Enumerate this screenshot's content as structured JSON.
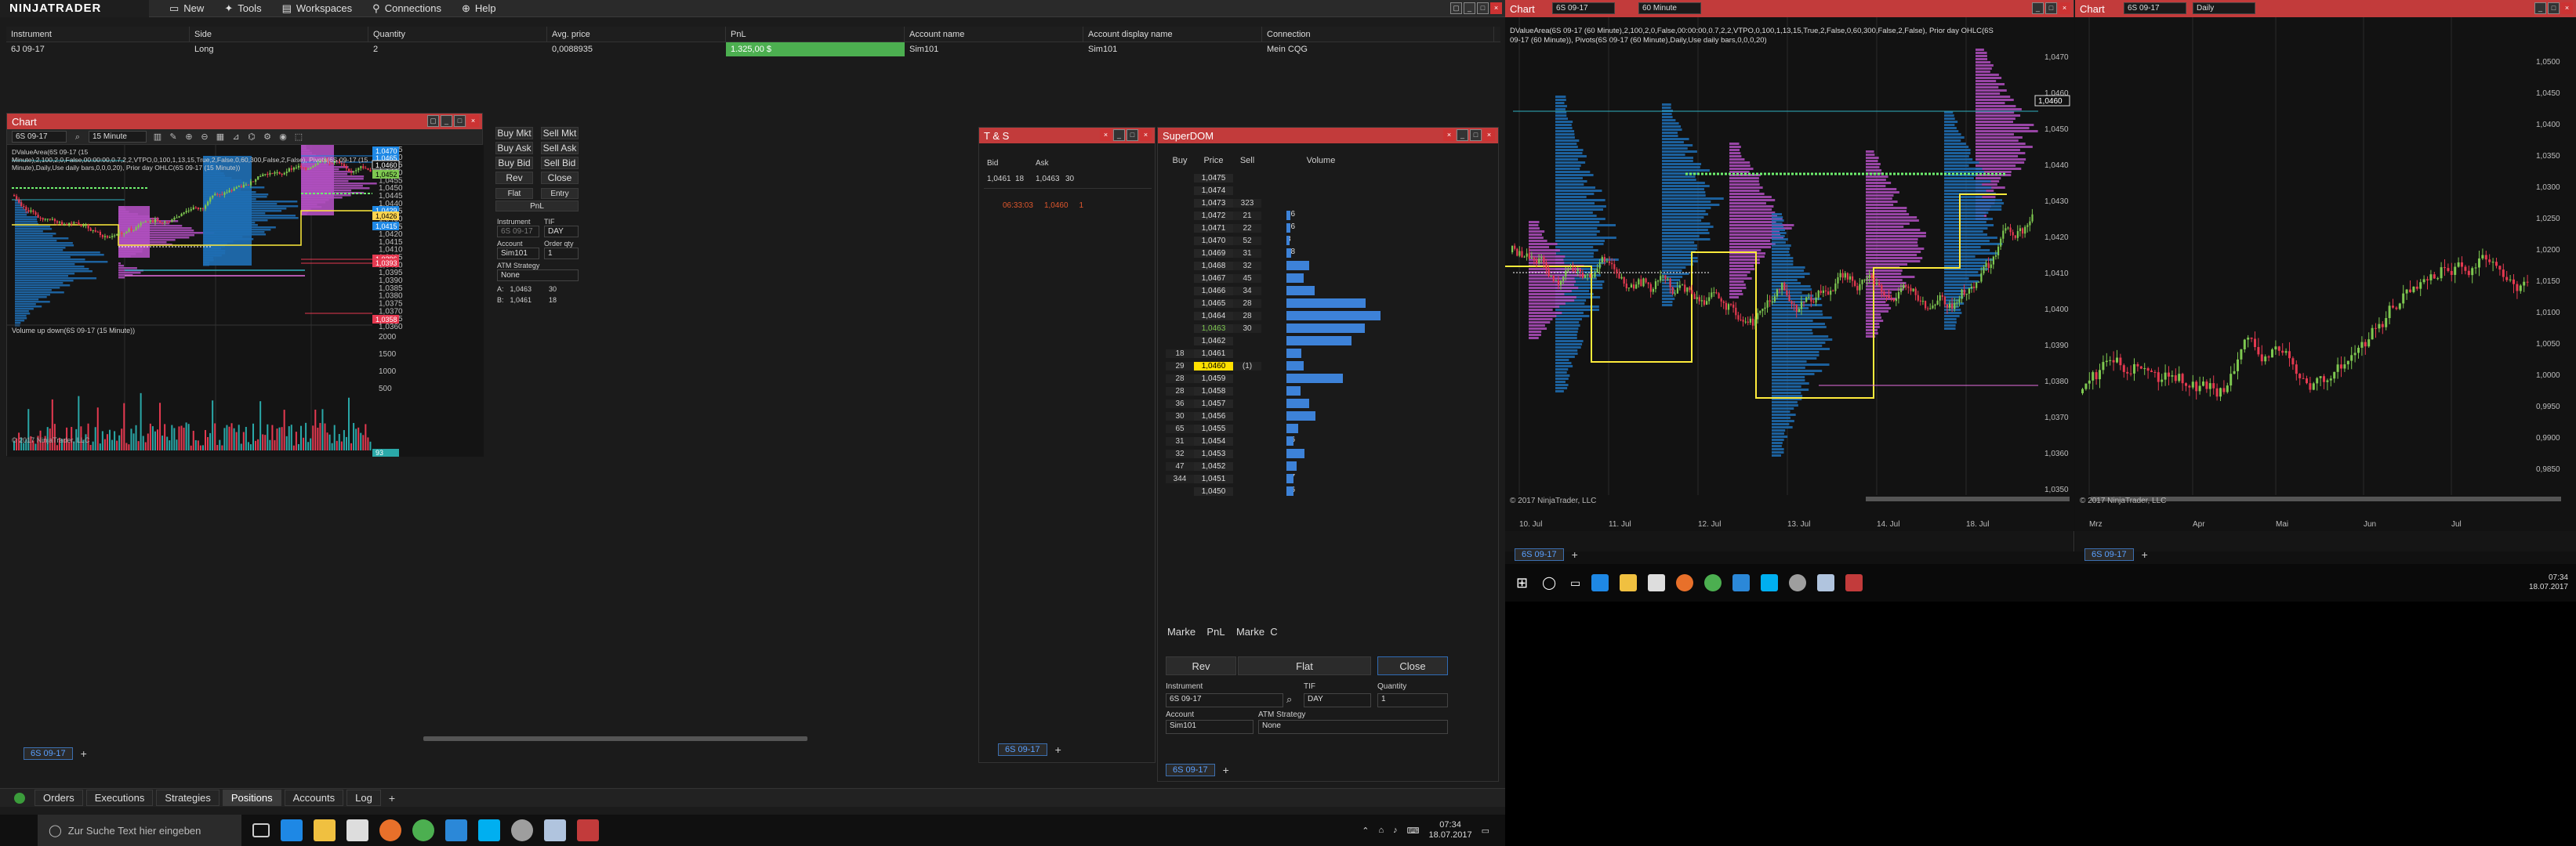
{
  "app": {
    "logo": "NINJATRADER",
    "menu": [
      {
        "label": "New",
        "icon": "new-icon"
      },
      {
        "label": "Tools",
        "icon": "tools-icon"
      },
      {
        "label": "Workspaces",
        "icon": "workspaces-icon"
      },
      {
        "label": "Connections",
        "icon": "connections-icon"
      },
      {
        "label": "Help",
        "icon": "help-icon"
      }
    ]
  },
  "positions": {
    "headers": [
      "Instrument",
      "Side",
      "Quantity",
      "Avg. price",
      "PnL",
      "Account name",
      "Account display name",
      "Connection"
    ],
    "rows": [
      [
        "6J 09-17",
        "Long",
        "2",
        "0,0088935",
        "1.325,00 $",
        "Sim101",
        "Sim101",
        "Mein CQG"
      ]
    ],
    "pnl_color": "#4caf50"
  },
  "main_chart": {
    "title": "Chart",
    "instrument": "6S 09-17",
    "interval": "15 Minute",
    "indicator_text": "DValueArea(6S 09-17 (15 Minute),2,100,2,0,False,00:00:00,0.7,2,2,VTPO,0,100,1,13,15,True,2,False,0,60,300,False,2,False), Pivots(6S 09-17 (15 Minute),Daily,Use daily bars,0,0,0,20), Prior day OHLC(6S 09-17 (15 Minute))",
    "copyright": "© 2017 NinjaTrader, LLC",
    "volume_label": "Volume up down(6S 09-17 (15 Minute))",
    "x_labels": [
      "14. Jul",
      "18. Jul"
    ],
    "y_labels": [
      "1,0475",
      "1,0470",
      "1,0465",
      "1,0460",
      "1,0455",
      "1,0450",
      "1,0445",
      "1,0440",
      "1,0435",
      "1,0430",
      "1,0425",
      "1,0420",
      "1,0415",
      "1,0410",
      "1,0405",
      "1,0400",
      "1,0395",
      "1,0390",
      "1,0385",
      "1,0380",
      "1,0375",
      "1,0370",
      "1,0365",
      "1,0360"
    ],
    "vol_labels": [
      "2000",
      "1500",
      "1000",
      "500",
      "93"
    ],
    "price_tags": [
      {
        "label": "1,0470",
        "color": "#1e88e5"
      },
      {
        "label": "1,0465",
        "color": "#1e88e5"
      },
      {
        "label": "1,0460",
        "color": "#111111"
      },
      {
        "label": "1,0452",
        "color": "#7ec850"
      },
      {
        "label": "1,0429",
        "color": "#1e88e5"
      },
      {
        "label": "1,0426",
        "color": "#ffd54f"
      },
      {
        "label": "1,0415",
        "color": "#1e88e5"
      },
      {
        "label": "1,0396",
        "color": "#e53950"
      },
      {
        "label": "1,0393",
        "color": "#e53950"
      },
      {
        "label": "1,0358",
        "color": "#e53950"
      }
    ],
    "tab": "6S 09-17",
    "vol_tag": "93"
  },
  "chart_trader": {
    "buttons": [
      "Buy Mkt",
      "Sell Mkt",
      "Buy Ask",
      "Sell Ask",
      "Buy Bid",
      "Sell Bid",
      "Rev",
      "Close"
    ],
    "flat": "Flat",
    "entry": "Entry",
    "pnl": "PnL",
    "instrument_label": "Instrument",
    "instrument_value": "6S 09-17",
    "tif_label": "TIF",
    "tif_value": "DAY",
    "account_label": "Account",
    "account_value": "Sim101",
    "qty_label": "Order qty",
    "qty_value": "1",
    "atm_label": "ATM Strategy",
    "atm_value": "None",
    "ask_label": "A:",
    "ask_price": "1,0463",
    "ask_size": "30",
    "bid_label": "B:",
    "bid_price": "1,0461",
    "bid_size": "18"
  },
  "ts": {
    "title": "T & S",
    "bid_label": "Bid",
    "ask_label": "Ask",
    "bid_price": "1,0461",
    "bid_size": "18",
    "ask_price": "1,0463",
    "ask_size": "30",
    "time": "06:33:03",
    "last_price": "1,0460",
    "last_size": "1",
    "tab": "6S 09-17"
  },
  "superdom": {
    "title": "SuperDOM",
    "headers": [
      "Buy",
      "Price",
      "Sell",
      "Volume"
    ],
    "rows": [
      {
        "buy": "",
        "price": "1,0475",
        "sell": "",
        "vol": ""
      },
      {
        "buy": "",
        "price": "1,0474",
        "sell": "",
        "vol": ""
      },
      {
        "buy": "",
        "price": "1,0473",
        "sell": "323",
        "vol": ""
      },
      {
        "buy": "",
        "price": "1,0472",
        "sell": "21",
        "vol": "16"
      },
      {
        "buy": "",
        "price": "1,0471",
        "sell": "22",
        "vol": "16"
      },
      {
        "buy": "",
        "price": "1,0470",
        "sell": "52",
        "vol": "8"
      },
      {
        "buy": "",
        "price": "1,0469",
        "sell": "31",
        "vol": "18"
      },
      {
        "buy": "",
        "price": "1,0468",
        "sell": "32",
        "vol": "87"
      },
      {
        "buy": "",
        "price": "1,0467",
        "sell": "45",
        "vol": "66"
      },
      {
        "buy": "",
        "price": "1,0466",
        "sell": "34",
        "vol": "108"
      },
      {
        "buy": "",
        "price": "1,0465",
        "sell": "28",
        "vol": "299"
      },
      {
        "buy": "",
        "price": "1,0464",
        "sell": "28",
        "vol": "356"
      },
      {
        "buy": "",
        "price": "1,0463",
        "sell": "30",
        "vol": "297"
      },
      {
        "buy": "",
        "price": "1,0462",
        "sell": "",
        "vol": "246"
      },
      {
        "buy": "18",
        "price": "1,0461",
        "sell": "",
        "vol": "56"
      },
      {
        "buy": "29",
        "price": "1,0460",
        "sell": "(1)",
        "vol": "64"
      },
      {
        "buy": "28",
        "price": "1,0459",
        "sell": "",
        "vol": "214"
      },
      {
        "buy": "28",
        "price": "1,0458",
        "sell": "",
        "vol": "52"
      },
      {
        "buy": "36",
        "price": "1,0457",
        "sell": "",
        "vol": "86"
      },
      {
        "buy": "30",
        "price": "1,0456",
        "sell": "",
        "vol": "109"
      },
      {
        "buy": "65",
        "price": "1,0455",
        "sell": "",
        "vol": "44"
      },
      {
        "buy": "31",
        "price": "1,0454",
        "sell": "",
        "vol": "26"
      },
      {
        "buy": "32",
        "price": "1,0453",
        "sell": "",
        "vol": "67"
      },
      {
        "buy": "47",
        "price": "1,0452",
        "sell": "",
        "vol": "38"
      },
      {
        "buy": "344",
        "price": "1,0451",
        "sell": "",
        "vol": "27"
      },
      {
        "buy": "",
        "price": "1,0450",
        "sell": "",
        "vol": "26"
      }
    ],
    "footer": [
      "Marke",
      "PnL",
      "Marke",
      "C"
    ],
    "rev": "Rev",
    "flat": "Flat",
    "close": "Close",
    "instrument_label": "Instrument",
    "instrument_value": "6S 09-17",
    "tif_label": "TIF",
    "tif_value": "DAY",
    "qty_label": "Quantity",
    "qty_value": "1",
    "account_label": "Account",
    "account_value": "Sim101",
    "atm_label": "ATM Strategy",
    "atm_value": "None",
    "tab": "6S 09-17"
  },
  "bottom_tabs": [
    "Orders",
    "Executions",
    "Strategies",
    "Positions",
    "Accounts",
    "Log"
  ],
  "active_bottom_tab": "Positions",
  "taskbar": {
    "search": "Zur Suche Text hier eingeben",
    "time": "07:34",
    "date": "18.07.2017"
  },
  "right_chart_60": {
    "title": "Chart",
    "instrument": "6S 09-17",
    "interval": "60 Minute",
    "indicator_text": "DValueArea(6S 09-17 (60 Minute),2,100,2,0,False,00:00:00,0.7,2,2,VTPO,0,100,1,13,15,True,2,False,0,60,300,False,2,False), Prior day OHLC(6S 09-17 (60 Minute)), Pivots(6S 09-17 (60 Minute),Daily,Use daily bars,0,0,0,20)",
    "copyright": "© 2017 NinjaTrader, LLC",
    "x_labels": [
      "10. Jul",
      "11. Jul",
      "12. Jul",
      "13. Jul",
      "14. Jul",
      "18. Jul"
    ],
    "y_labels": [
      "1,0470",
      "1,0460",
      "1,0450",
      "1,0440",
      "1,0430",
      "1,0420",
      "1,0410",
      "1,0400",
      "1,0390",
      "1,0380",
      "1,0370",
      "1,0360",
      "1,0350"
    ],
    "tab": "6S 09-17",
    "current": "1,0460"
  },
  "right_chart_daily": {
    "title": "Chart",
    "instrument": "6S 09-17",
    "interval": "Daily",
    "copyright": "© 2017 NinjaTrader, LLC",
    "x_labels": [
      "Mrz",
      "Apr",
      "Mai",
      "Jun",
      "Jul"
    ],
    "y_labels": [
      "1,0500",
      "1,0450",
      "1,0400",
      "1,0350",
      "1,0300",
      "1,0250",
      "1,0200",
      "1,0150",
      "1,0100",
      "1,0050",
      "1,0000",
      "0,9950",
      "0,9900",
      "0,9850"
    ],
    "tab": "6S 09-17"
  },
  "right_taskbar": {
    "time": "07:34",
    "date": "18.07.2017"
  },
  "colors": {
    "accent_red": "#c23b3b",
    "up": "#4caf50",
    "down": "#e53950",
    "value_area_blue": "#1f6fb5",
    "value_area_purple": "#b04fc0"
  }
}
